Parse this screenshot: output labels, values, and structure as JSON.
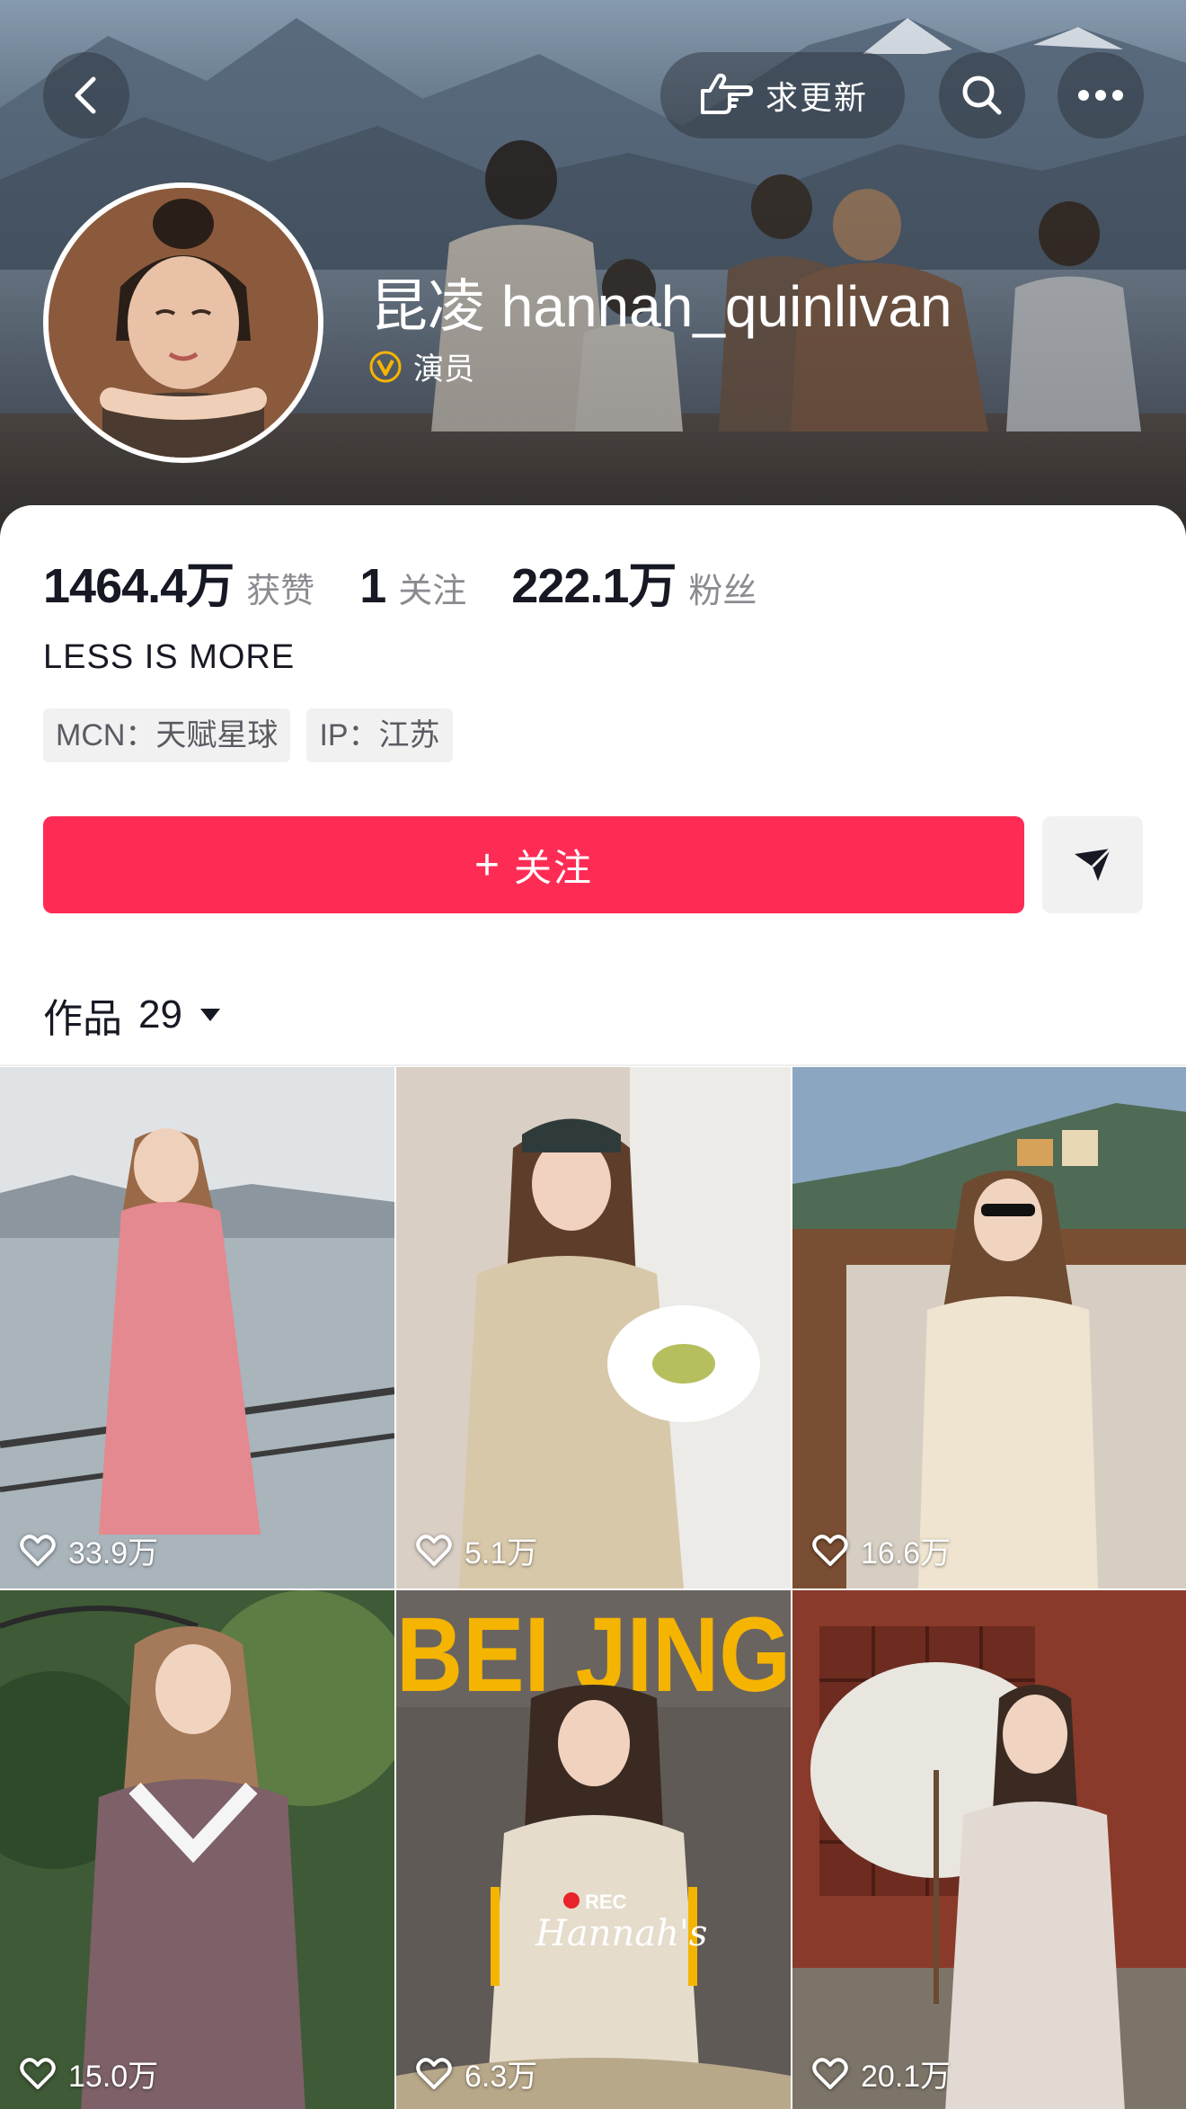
{
  "header": {
    "update_label": "求更新",
    "name": "昆凌 hannah_quinlivan",
    "verified_label": "演员"
  },
  "stats": [
    {
      "value": "1464.4万",
      "label": "获赞"
    },
    {
      "value": "1",
      "label": "关注"
    },
    {
      "value": "222.1万",
      "label": "粉丝"
    }
  ],
  "bio": "LESS IS MORE",
  "tags": [
    "MCN：天赋星球",
    "IP：江苏"
  ],
  "actions": {
    "follow_plus": "+",
    "follow_label": "关注"
  },
  "works": {
    "label": "作品",
    "count": "29"
  },
  "grid": [
    {
      "likes": "33.9万"
    },
    {
      "likes": "5.1万"
    },
    {
      "likes": "16.6万"
    },
    {
      "likes": "15.0万"
    },
    {
      "likes": "6.3万"
    },
    {
      "likes": "20.1万"
    }
  ],
  "video_overlays": {
    "beijing_title": "BEI JING",
    "rec": "REC",
    "series_title": "Hannah's"
  },
  "colors": {
    "accent": "#fe2c55",
    "verified": "#f7b500"
  }
}
